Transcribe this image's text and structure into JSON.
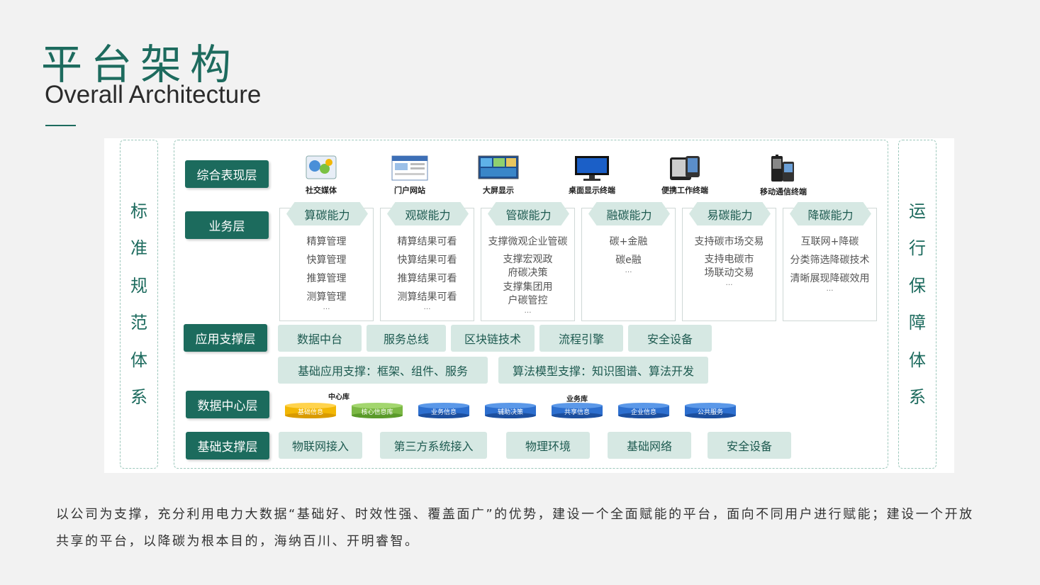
{
  "header": {
    "title_cn": "平台架构",
    "title_en": "Overall Architecture"
  },
  "left_side": [
    "标",
    "准",
    "规",
    "范",
    "体",
    "系"
  ],
  "right_side": [
    "运",
    "行",
    "保",
    "障",
    "体",
    "系"
  ],
  "layers": {
    "presentation": "综合表现层",
    "business": "业务层",
    "app_support": "应用支撑层",
    "data_center": "数据中心层",
    "infra": "基础支撑层"
  },
  "devices": [
    {
      "label": "社交媒体",
      "icon": "social-media-icon"
    },
    {
      "label": "门户网站",
      "icon": "portal-website-icon"
    },
    {
      "label": "大屏显示",
      "icon": "big-screen-icon"
    },
    {
      "label": "桌面显示终端",
      "icon": "desktop-monitor-icon"
    },
    {
      "label": "便携工作终端",
      "icon": "tablet-icon"
    },
    {
      "label": "移动通信终端",
      "icon": "mobile-phone-icon"
    }
  ],
  "business": [
    {
      "title": "算碳能力",
      "items": [
        "精算管理",
        "快算管理",
        "推算管理",
        "测算管理",
        "…"
      ]
    },
    {
      "title": "观碳能力",
      "items": [
        "精算结果可看",
        "快算结果可看",
        "推算结果可看",
        "测算结果可看",
        "…"
      ]
    },
    {
      "title": "管碳能力",
      "items": [
        "支撑微观企业管碳",
        "支撑宏观政府碳决策",
        "支撑集团用户碳管控",
        "…"
      ]
    },
    {
      "title": "融碳能力",
      "items": [
        "碳+金融",
        "碳e融",
        "…"
      ]
    },
    {
      "title": "易碳能力",
      "items": [
        "支持碳市场交易",
        "支持电碳市场联动交易",
        "…"
      ]
    },
    {
      "title": "降碳能力",
      "items": [
        "互联网+降碳",
        "分类筛选降碳技术",
        "清晰展现降碳效用",
        "…"
      ]
    }
  ],
  "app_support_row1": [
    "数据中台",
    "服务总线",
    "区块链技术",
    "流程引擎",
    "安全设备"
  ],
  "app_support_row2": [
    "基础应用支撑：框架、组件、服务",
    "算法模型支撑：知识图谱、算法开发"
  ],
  "databases": {
    "center_caption": "中心库",
    "business_caption": "业务库",
    "items": [
      {
        "label": "基础信息",
        "color": "#f2b705"
      },
      {
        "label": "核心信息库",
        "color": "#7bb844"
      },
      {
        "label": "业务信息",
        "color": "#2d6fcf"
      },
      {
        "label": "辅助决策",
        "color": "#2d6fcf"
      },
      {
        "label": "共享信息",
        "color": "#2d6fcf"
      },
      {
        "label": "企业信息",
        "color": "#2d6fcf"
      },
      {
        "label": "公共服务",
        "color": "#2d6fcf"
      }
    ]
  },
  "infra": [
    "物联网接入",
    "第三方系统接入",
    "物理环境",
    "基础网络",
    "安全设备"
  ],
  "description": "以公司为支撑，充分利用电力大数据“基础好、时效性强、覆盖面广”的优势，建设一个全面赋能的平台，面向不同用户进行赋能；建设一个开放共享的平台，以降碳为根本目的，海纳百川、开明睿智。"
}
